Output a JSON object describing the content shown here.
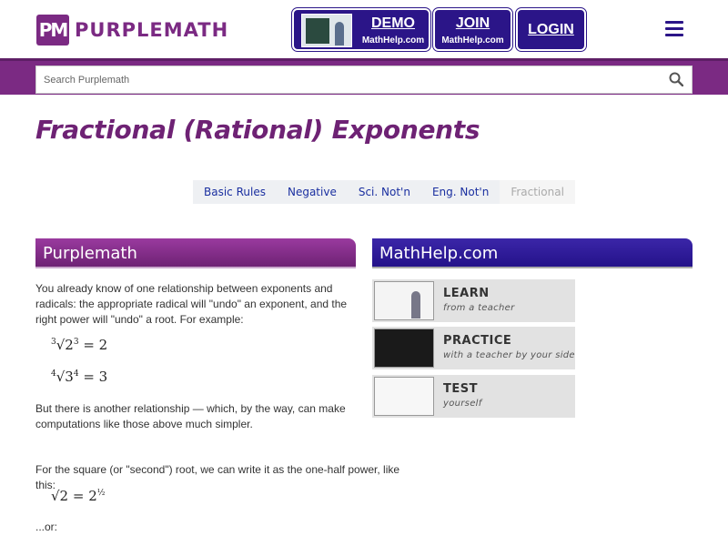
{
  "header": {
    "logo_mark": "PM",
    "logo_text": "PURPLEMATH",
    "demo_label": "DEMO",
    "demo_sub": "MathHelp.com",
    "join_label": "JOIN",
    "join_sub": "MathHelp.com",
    "login_label": "LOGIN"
  },
  "search": {
    "placeholder": "Search Purplemath"
  },
  "page_title": "Fractional (Rational) Exponents",
  "tabs": [
    {
      "label": "Basic Rules"
    },
    {
      "label": "Negative"
    },
    {
      "label": "Sci. Not'n"
    },
    {
      "label": "Eng. Not'n"
    },
    {
      "label": "Fractional"
    }
  ],
  "left_panel": {
    "heading": "Purplemath",
    "para1": "You already know of one relationship between exponents and radicals: the appropriate radical will \"undo\" an exponent, and the right power will \"undo\" a root. For example:",
    "para2": "But there is another relationship — which, by the way, can make computations like those above much simpler.",
    "para3": "For the square (or \"second\") root, we can write it as the one-half power, like this:",
    "para4": "...or:"
  },
  "right_panel": {
    "heading": "MathHelp.com",
    "cards": [
      {
        "title": "LEARN",
        "subtitle": "from a teacher"
      },
      {
        "title": "PRACTICE",
        "subtitle": "with a teacher by your side"
      },
      {
        "title": "TEST",
        "subtitle": "yourself"
      }
    ]
  },
  "colors": {
    "purple": "#7b2a83",
    "navy": "#2b1588",
    "link": "#1a2fa0"
  }
}
